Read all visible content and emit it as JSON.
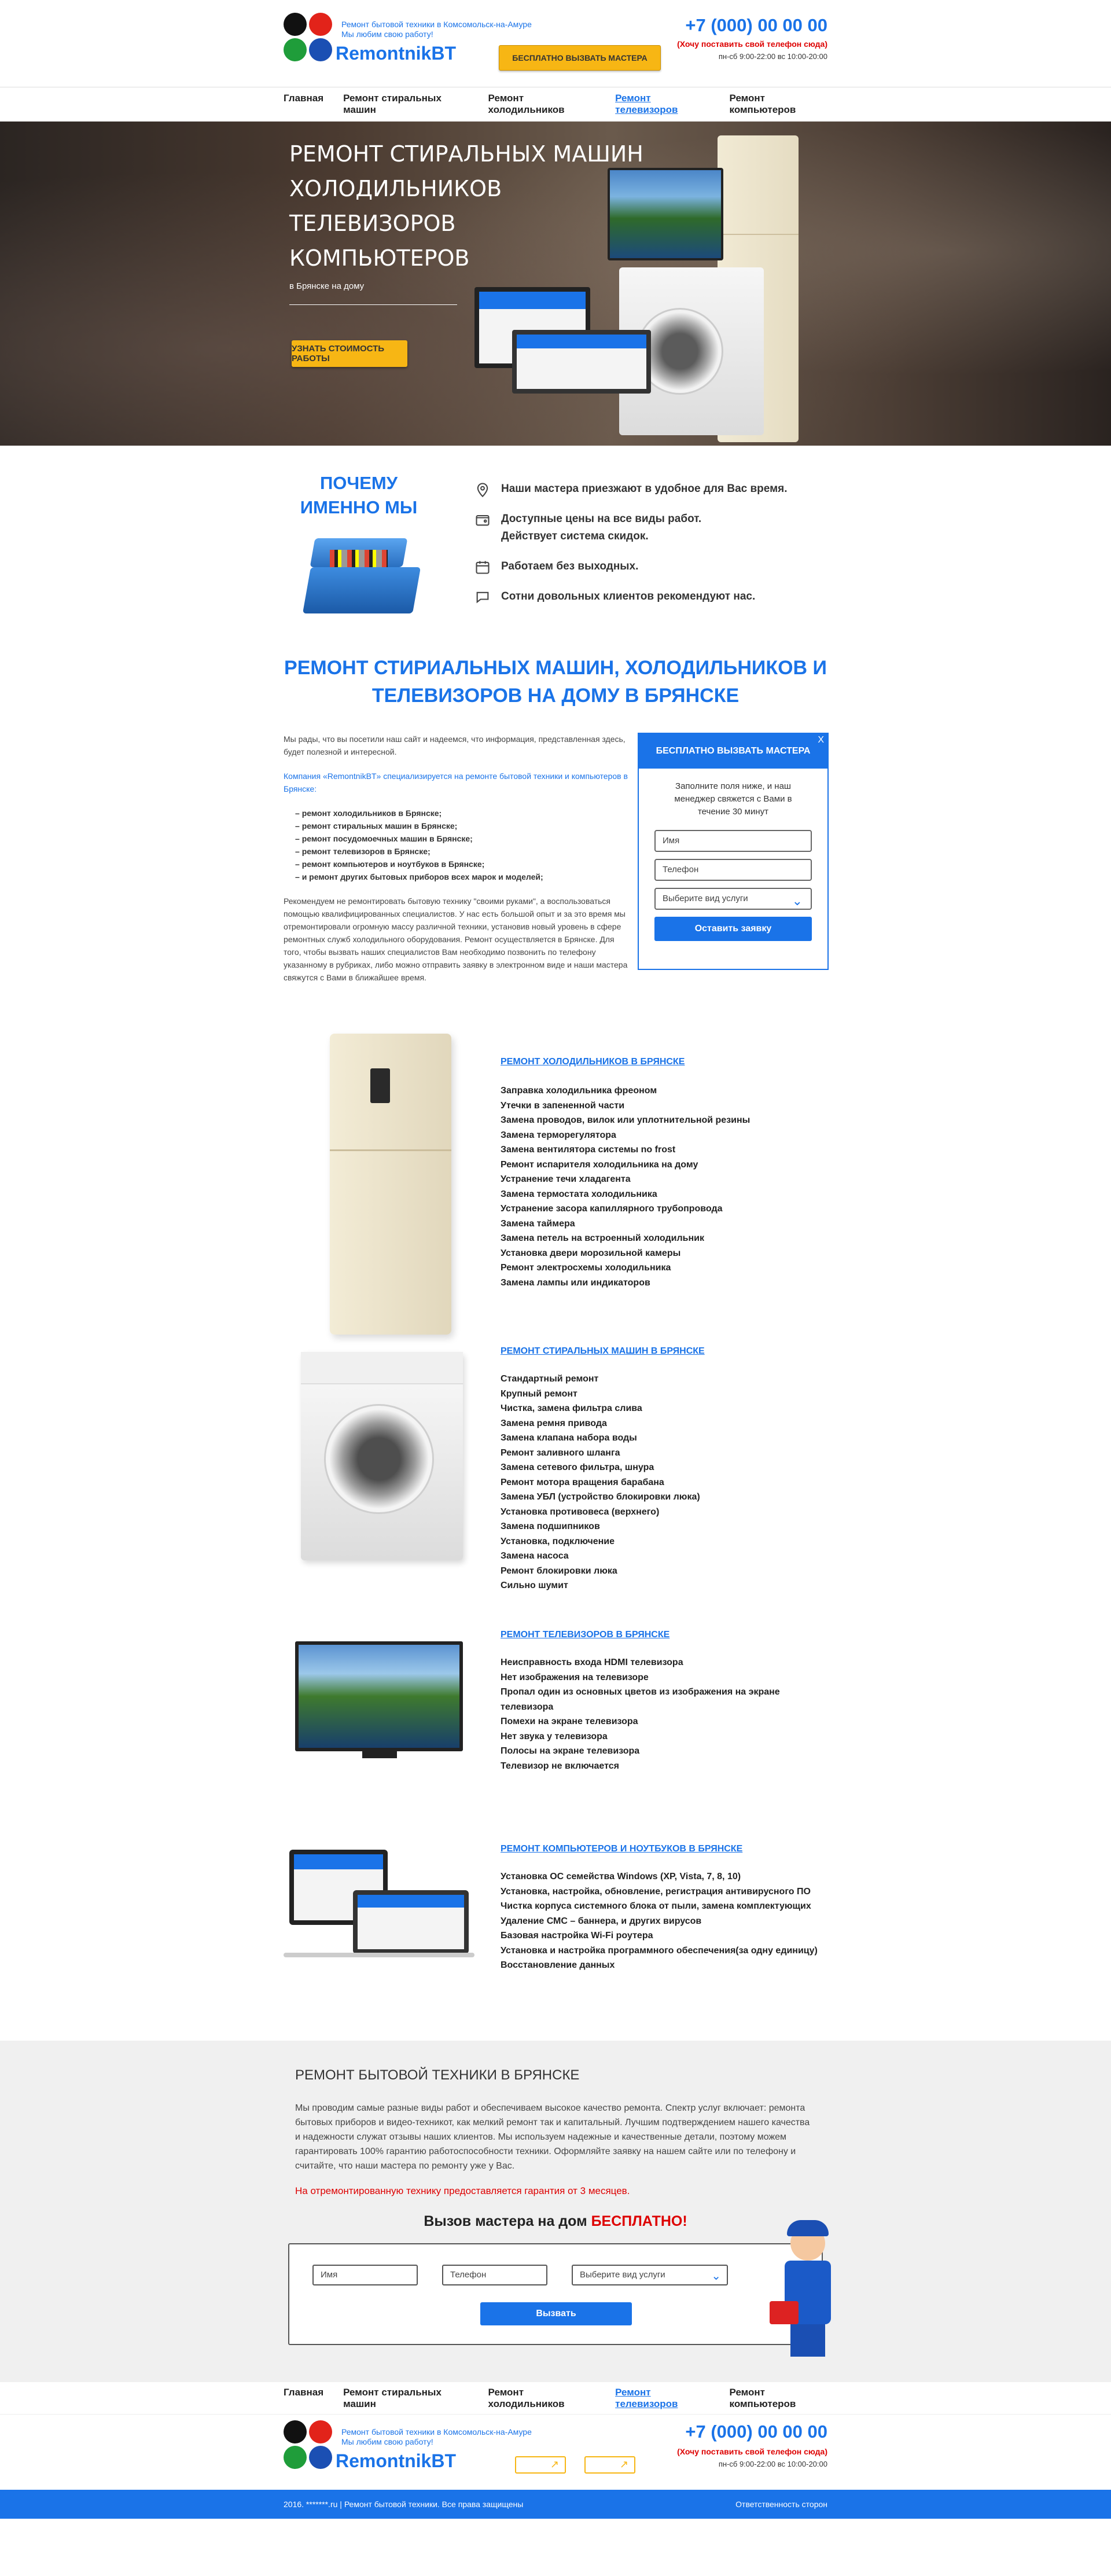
{
  "header": {
    "tagline1": "Ремонт бытовой техники в Комсомольск-на-Амуре",
    "tagline2": "Мы любим свою работу!",
    "brand": "RemontnikBT",
    "cta": "БЕСПЛАТНО ВЫЗВАТЬ МАСТЕРА",
    "phone": "+7 (000) 00 00 00",
    "phone_hint": "(Хочу поставить свой телефон сюда)",
    "hours": "пн-сб 9:00-22:00 вс 10:00-20:00"
  },
  "nav": [
    "Главная",
    "Ремонт стиральных машин",
    "Ремонт холодильников",
    "Ремонт телевизоров",
    "Ремонт компьютеров"
  ],
  "hero": {
    "lines": [
      "Ремонт стиральных машин",
      "Холодильников",
      "Телевизоров",
      "Компьютеров"
    ],
    "sub": "в Брянске на дому",
    "button": "УЗНАТЬ СТОИМОСТЬ РАБОТЫ"
  },
  "why": {
    "title": "Почему именно мы",
    "items": [
      "Наши мастера приезжают в удобное для Вас время.",
      "Доступные цены на все виды работ. Действует система скидок.",
      "Работаем без выходных.",
      "Сотни довольных клиентов рекомендуют нас."
    ]
  },
  "repair": {
    "title": "Ремонт стириальных машин, холодильников и телевизоров на дому в Брянске",
    "p1": "Мы рады, что вы посетили наш сайт и надеемся, что информация, представленная здесь, будет полезной и интересной.",
    "p2": "Компания «RemontnikBT» специализируется на ремонте бытовой техники и компьютеров в Брянске:",
    "list": [
      "ремонт холодильников в Брянске;",
      "ремонт стиральных машин в Брянске;",
      "ремонт посудомоечных машин в Брянске;",
      "ремонт телевизоров в Брянске;",
      "ремонт компьютеров и ноутбуков в Брянске;",
      "и ремонт других бытовых приборов всех марок и моделей;"
    ],
    "p3": "Рекомендуем не ремонтировать бытовую технику \"своими руками\", а воспользоваться помощью квалифицированных специалистов. У нас есть большой опыт и за это время мы отремонтировали огромную массу различной техники, установив новый уровень в сфере ремонтных служб холодильного оборудования. Ремонт осуществляется в Брянске. Для того, чтобы вызвать наших специалистов Вам необходимо позвонить по телефону указанному в рубриках, либо можно отправить заявку в электронном виде и наши мастера свяжутся с Вами в ближайшее время."
  },
  "form": {
    "title": "БЕСПЛАТНО ВЫЗВАТЬ МАСТЕРА",
    "close": "X",
    "desc": "Заполните поля ниже, и наш менеджер свяжется с Вами в течение 30 минут",
    "name_ph": "Имя",
    "phone_ph": "Телефон",
    "select": "Выберите вид услуги",
    "submit": "Оставить заявку"
  },
  "services": [
    {
      "title": "РЕМОНТ ХОЛОДИЛЬНИКОВ В БРЯНСКЕ",
      "items": [
        "Заправка холодильника фреоном",
        "Утечки в запененной части",
        "Замена проводов, вилок или уплотнительной резины",
        "Замена терморегулятора",
        "Замена вентилятора системы no frost",
        "Ремонт испарителя холодильника на дому",
        "Устранение течи хладагента",
        "Замена термостата холодильника",
        "Устранение засора капиллярного трубопровода",
        "Замена таймера",
        "Замена петель на встроенный холодильник",
        "Установка двери морозильной камеры",
        "Ремонт электросхемы холодильника",
        "Замена лампы или индикаторов"
      ]
    },
    {
      "title": "РЕМОНТ СТИРАЛЬНЫХ МАШИН В БРЯНСКЕ",
      "items": [
        "Стандартный ремонт",
        "Крупный ремонт",
        "Чистка, замена фильтра слива",
        "Замена ремня привода",
        "Замена клапана набора воды",
        "Ремонт заливного шланга",
        "Замена сетевого фильтра, шнура",
        "Ремонт мотора вращения барабана",
        "Замена УБЛ (устройство блокировки люка)",
        "Установка противовеса (верхнего)",
        "Замена подшипников",
        "Установка, подключение",
        "Замена насоса",
        "Ремонт блокировки люка",
        "Сильно шумит"
      ]
    },
    {
      "title": "РЕМОНТ ТЕЛЕВИЗОРОВ В БРЯНСКЕ",
      "items": [
        "Неисправность входа HDMI телевизора",
        "Нет изображения на телевизоре",
        "Пропал один из основных цветов из изображения на экране телевизора",
        "Помехи на экране телевизора",
        "Нет звука у телевизора",
        "Полосы на экране телевизора",
        "Телевизор не включается"
      ]
    },
    {
      "title": "РЕМОНТ КОМПЬЮТЕРОВ И НОУТБУКОВ В БРЯНСКЕ",
      "items": [
        "Установка ОС семейства Windows (XP, Vista, 7, 8, 10)",
        "Установка, настройка, обновление, регистрация антивирусного ПО",
        "Чистка корпуса системного блока от пыли, замена комплектующих",
        "Удаление СМС – баннера, и других вирусов",
        "Базовая настройка Wi-Fi роутера",
        "Установка и настройка программного обеспечения(за одну единицу)",
        "Восстановление данных"
      ]
    }
  ],
  "info": {
    "title": "РЕМОНТ БЫТОВОЙ ТЕХНИКИ В БРЯНСКЕ",
    "text": "Мы проводим самые разные виды работ и обеспечиваем высокое качество ремонта. Спектр услуг включает: ремонта бытовых приборов и видео-техникот, как мелкий ремонт так и капитальный. Лучшим подтверждением нашего качества и надежности служат отзывы наших клиентов. Мы используем надежные и качественные детали, поэтому можем гарантировать 100% гарантию работоспособности техники. Оформляйте заявку на нашем сайте или по телефону и считайте, что наши мастера по ремонту уже у Вас.",
    "note": "На отремонтированную технику предоставляется гарантия от 3 месяцев.",
    "call_title": "Вызов мастера на дом",
    "call_free": "БЕСПЛАТНО!",
    "name_ph": "Имя",
    "phone_ph": "Телефон",
    "select": "Выберите вид услуги",
    "button": "Вызвать"
  },
  "footer": {
    "copyright": "2016. *******.ru | Ремонт бытовой техники. Все права защищены",
    "responsibility": "Ответственность сторон"
  },
  "colors": {
    "accent": "#1a73e8",
    "cta": "#f7b614",
    "alert": "#dd0000"
  }
}
